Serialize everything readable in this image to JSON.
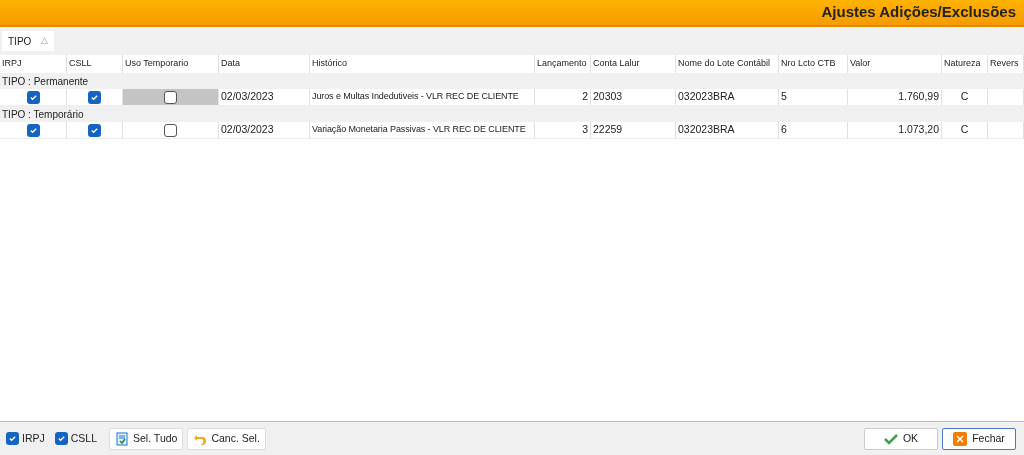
{
  "window": {
    "title": "Ajustes Adições/Exclusões"
  },
  "group_panel": {
    "label": "TIPO",
    "sort_icon": "△"
  },
  "table": {
    "columns": [
      "IRPJ",
      "CSLL",
      "Uso Temporario",
      "Data",
      "Histórico",
      "Lançamento",
      "Conta Lalur",
      "Nome do Lote Contábil",
      "Nro Lcto CTB",
      "Valor",
      "Natureza",
      "Revers"
    ],
    "groups": [
      {
        "label": "TIPO : Permanente",
        "rows": [
          {
            "irpj": true,
            "csll": true,
            "uso_temporario": false,
            "uso_focused": true,
            "data": "02/03/2023",
            "historico": "Juros e Multas Indedutiveis - VLR REC DE CLIENTE",
            "lancamento": "2",
            "conta_lalur": "20303",
            "lote": "032023BRA",
            "nro_lcto": "5",
            "valor": "1.760,99",
            "natureza": "C"
          }
        ]
      },
      {
        "label": "TIPO : Temporário",
        "rows": [
          {
            "irpj": true,
            "csll": true,
            "uso_temporario": false,
            "uso_focused": false,
            "data": "02/03/2023",
            "historico": "Variação Monetaria Passivas - VLR REC DE CLIENTE",
            "lancamento": "3",
            "conta_lalur": "22259",
            "lote": "032023BRA",
            "nro_lcto": "6",
            "valor": "1.073,20",
            "natureza": "C"
          }
        ]
      }
    ]
  },
  "footer": {
    "checks": [
      {
        "label": "IRPJ",
        "checked": true
      },
      {
        "label": "CSLL",
        "checked": true
      }
    ],
    "buttons": [
      {
        "label": "Sel. Tudo",
        "kind": "select"
      },
      {
        "label": "Canc. Sel.",
        "kind": "undo"
      }
    ],
    "dialog_buttons": [
      {
        "label": "OK",
        "kind": "ok"
      },
      {
        "label": "Fechar",
        "kind": "close"
      }
    ]
  }
}
